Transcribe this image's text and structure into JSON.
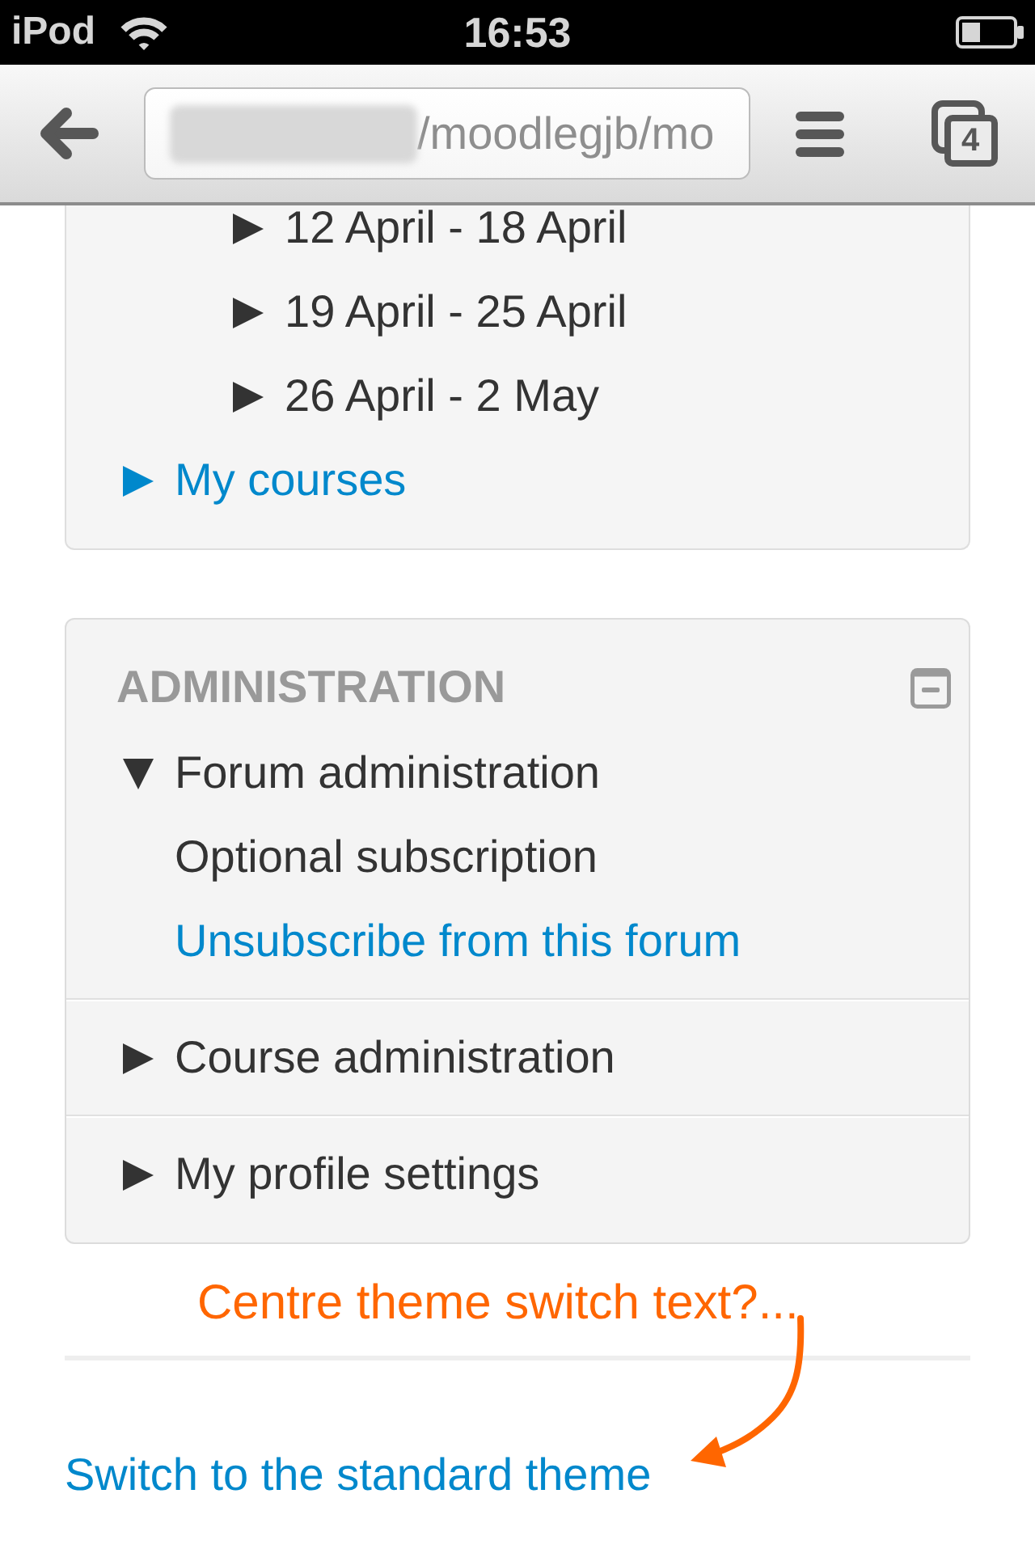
{
  "status_bar": {
    "device": "iPod",
    "time": "16:53"
  },
  "browser_toolbar": {
    "address": "/moodlegjb/mo",
    "tab_count": "4"
  },
  "navigation_block": {
    "continued_items": [
      {
        "label": "12 April - 18 April",
        "expanded": false,
        "link": false
      },
      {
        "label": "19 April - 25 April",
        "expanded": false,
        "link": false
      },
      {
        "label": "26 April - 2 May",
        "expanded": false,
        "link": false
      }
    ],
    "items": [
      {
        "label": "My courses",
        "expanded": false,
        "link": true
      }
    ]
  },
  "administration_block": {
    "title": "ADMINISTRATION",
    "items": [
      {
        "label": "Forum administration",
        "expanded": true,
        "link": false,
        "children": [
          {
            "label": "Optional subscription",
            "link": false
          },
          {
            "label": "Unsubscribe from this forum",
            "link": true
          }
        ]
      },
      {
        "label": "Course administration",
        "expanded": false,
        "link": false
      },
      {
        "label": "My profile settings",
        "expanded": false,
        "link": false
      }
    ]
  },
  "annotation": {
    "text": "Centre theme switch text?..."
  },
  "footer": {
    "theme_link": "Switch to the standard theme"
  }
}
